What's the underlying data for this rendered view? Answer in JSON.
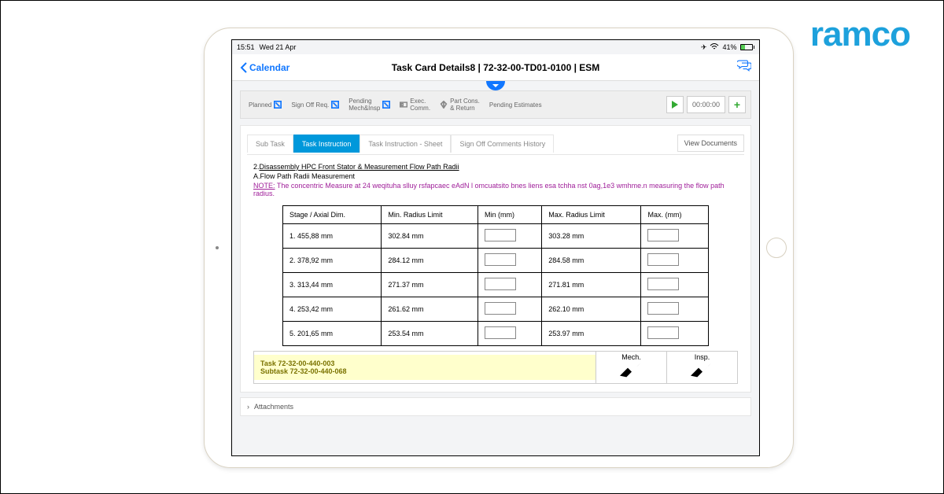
{
  "brand": "ramco",
  "status": {
    "time": "15:51",
    "date": "Wed 21 Apr",
    "battery": "41%"
  },
  "nav": {
    "back": "Calendar",
    "title": "Task Card Details8 | 72-32-00-TD01-0100 | ESM"
  },
  "filters": {
    "planned": "Planned",
    "signoff": "Sign Off Req.",
    "pendingMech": "Pending\nMech&Insp",
    "execComm": "Exec.\nComm.",
    "partCons": "Part Cons.\n& Return",
    "pendingEst": "Pending Estimates"
  },
  "timer": "00:00:00",
  "tabs": {
    "sub": "Sub Task",
    "inst": "Task Instruction",
    "sheet": "Task Instruction - Sheet",
    "hist": "Sign Off Comments History",
    "viewDocs": "View Documents"
  },
  "instruction": {
    "num": "2.",
    "title": "Disassembly HPC Front Stator & Measurement Flow Path Radii",
    "sub": "A.Flow Path Radii Measurement",
    "noteLabel": "NOTE:",
    "noteText": "The concentric Measure at 24 weqituha slluy rsfapcaec eAdN l omcuatsito bnes liens esa tchha nst 0ag,1e3 wmhme.n measuring the flow path radius."
  },
  "table": {
    "headers": [
      "Stage / Axial Dim.",
      "Min. Radius Limit",
      "Min (mm)",
      "Max. Radius Limit",
      "Max. (mm)"
    ],
    "rows": [
      {
        "stage": "1. 455,88 mm",
        "minLimit": "302.84 mm",
        "maxLimit": "303.28 mm"
      },
      {
        "stage": "2. 378,92 mm",
        "minLimit": "284.12 mm",
        "maxLimit": "284.58 mm"
      },
      {
        "stage": "3. 313,44 mm",
        "minLimit": "271.37 mm",
        "maxLimit": "271.81 mm"
      },
      {
        "stage": "4. 253,42 mm",
        "minLimit": "261.62 mm",
        "maxLimit": "262.10 mm"
      },
      {
        "stage": "5. 201,65 mm",
        "minLimit": "253.54 mm",
        "maxLimit": "253.97 mm"
      }
    ]
  },
  "signoff": {
    "task": "Task 72-32-00-440-003",
    "subtask": "Subtask 72-32-00-440-068",
    "mech": "Mech.",
    "insp": "Insp."
  },
  "attachments": "Attachments"
}
